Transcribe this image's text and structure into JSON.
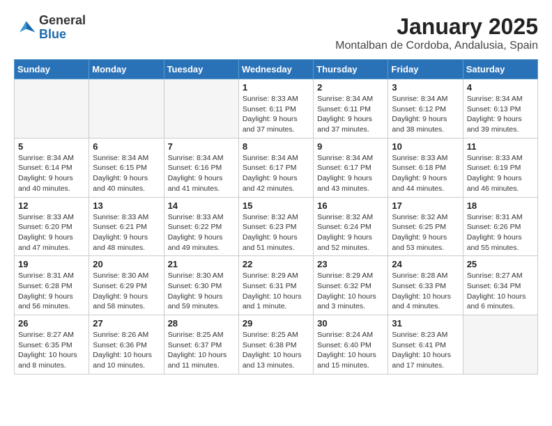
{
  "logo": {
    "general": "General",
    "blue": "Blue"
  },
  "title": "January 2025",
  "location": "Montalban de Cordoba, Andalusia, Spain",
  "weekdays": [
    "Sunday",
    "Monday",
    "Tuesday",
    "Wednesday",
    "Thursday",
    "Friday",
    "Saturday"
  ],
  "weeks": [
    [
      {
        "day": "",
        "info": ""
      },
      {
        "day": "",
        "info": ""
      },
      {
        "day": "",
        "info": ""
      },
      {
        "day": "1",
        "info": "Sunrise: 8:33 AM\nSunset: 6:11 PM\nDaylight: 9 hours\nand 37 minutes."
      },
      {
        "day": "2",
        "info": "Sunrise: 8:34 AM\nSunset: 6:11 PM\nDaylight: 9 hours\nand 37 minutes."
      },
      {
        "day": "3",
        "info": "Sunrise: 8:34 AM\nSunset: 6:12 PM\nDaylight: 9 hours\nand 38 minutes."
      },
      {
        "day": "4",
        "info": "Sunrise: 8:34 AM\nSunset: 6:13 PM\nDaylight: 9 hours\nand 39 minutes."
      }
    ],
    [
      {
        "day": "5",
        "info": "Sunrise: 8:34 AM\nSunset: 6:14 PM\nDaylight: 9 hours\nand 40 minutes."
      },
      {
        "day": "6",
        "info": "Sunrise: 8:34 AM\nSunset: 6:15 PM\nDaylight: 9 hours\nand 40 minutes."
      },
      {
        "day": "7",
        "info": "Sunrise: 8:34 AM\nSunset: 6:16 PM\nDaylight: 9 hours\nand 41 minutes."
      },
      {
        "day": "8",
        "info": "Sunrise: 8:34 AM\nSunset: 6:17 PM\nDaylight: 9 hours\nand 42 minutes."
      },
      {
        "day": "9",
        "info": "Sunrise: 8:34 AM\nSunset: 6:17 PM\nDaylight: 9 hours\nand 43 minutes."
      },
      {
        "day": "10",
        "info": "Sunrise: 8:33 AM\nSunset: 6:18 PM\nDaylight: 9 hours\nand 44 minutes."
      },
      {
        "day": "11",
        "info": "Sunrise: 8:33 AM\nSunset: 6:19 PM\nDaylight: 9 hours\nand 46 minutes."
      }
    ],
    [
      {
        "day": "12",
        "info": "Sunrise: 8:33 AM\nSunset: 6:20 PM\nDaylight: 9 hours\nand 47 minutes."
      },
      {
        "day": "13",
        "info": "Sunrise: 8:33 AM\nSunset: 6:21 PM\nDaylight: 9 hours\nand 48 minutes."
      },
      {
        "day": "14",
        "info": "Sunrise: 8:33 AM\nSunset: 6:22 PM\nDaylight: 9 hours\nand 49 minutes."
      },
      {
        "day": "15",
        "info": "Sunrise: 8:32 AM\nSunset: 6:23 PM\nDaylight: 9 hours\nand 51 minutes."
      },
      {
        "day": "16",
        "info": "Sunrise: 8:32 AM\nSunset: 6:24 PM\nDaylight: 9 hours\nand 52 minutes."
      },
      {
        "day": "17",
        "info": "Sunrise: 8:32 AM\nSunset: 6:25 PM\nDaylight: 9 hours\nand 53 minutes."
      },
      {
        "day": "18",
        "info": "Sunrise: 8:31 AM\nSunset: 6:26 PM\nDaylight: 9 hours\nand 55 minutes."
      }
    ],
    [
      {
        "day": "19",
        "info": "Sunrise: 8:31 AM\nSunset: 6:28 PM\nDaylight: 9 hours\nand 56 minutes."
      },
      {
        "day": "20",
        "info": "Sunrise: 8:30 AM\nSunset: 6:29 PM\nDaylight: 9 hours\nand 58 minutes."
      },
      {
        "day": "21",
        "info": "Sunrise: 8:30 AM\nSunset: 6:30 PM\nDaylight: 9 hours\nand 59 minutes."
      },
      {
        "day": "22",
        "info": "Sunrise: 8:29 AM\nSunset: 6:31 PM\nDaylight: 10 hours\nand 1 minute."
      },
      {
        "day": "23",
        "info": "Sunrise: 8:29 AM\nSunset: 6:32 PM\nDaylight: 10 hours\nand 3 minutes."
      },
      {
        "day": "24",
        "info": "Sunrise: 8:28 AM\nSunset: 6:33 PM\nDaylight: 10 hours\nand 4 minutes."
      },
      {
        "day": "25",
        "info": "Sunrise: 8:27 AM\nSunset: 6:34 PM\nDaylight: 10 hours\nand 6 minutes."
      }
    ],
    [
      {
        "day": "26",
        "info": "Sunrise: 8:27 AM\nSunset: 6:35 PM\nDaylight: 10 hours\nand 8 minutes."
      },
      {
        "day": "27",
        "info": "Sunrise: 8:26 AM\nSunset: 6:36 PM\nDaylight: 10 hours\nand 10 minutes."
      },
      {
        "day": "28",
        "info": "Sunrise: 8:25 AM\nSunset: 6:37 PM\nDaylight: 10 hours\nand 11 minutes."
      },
      {
        "day": "29",
        "info": "Sunrise: 8:25 AM\nSunset: 6:38 PM\nDaylight: 10 hours\nand 13 minutes."
      },
      {
        "day": "30",
        "info": "Sunrise: 8:24 AM\nSunset: 6:40 PM\nDaylight: 10 hours\nand 15 minutes."
      },
      {
        "day": "31",
        "info": "Sunrise: 8:23 AM\nSunset: 6:41 PM\nDaylight: 10 hours\nand 17 minutes."
      },
      {
        "day": "",
        "info": ""
      }
    ]
  ]
}
